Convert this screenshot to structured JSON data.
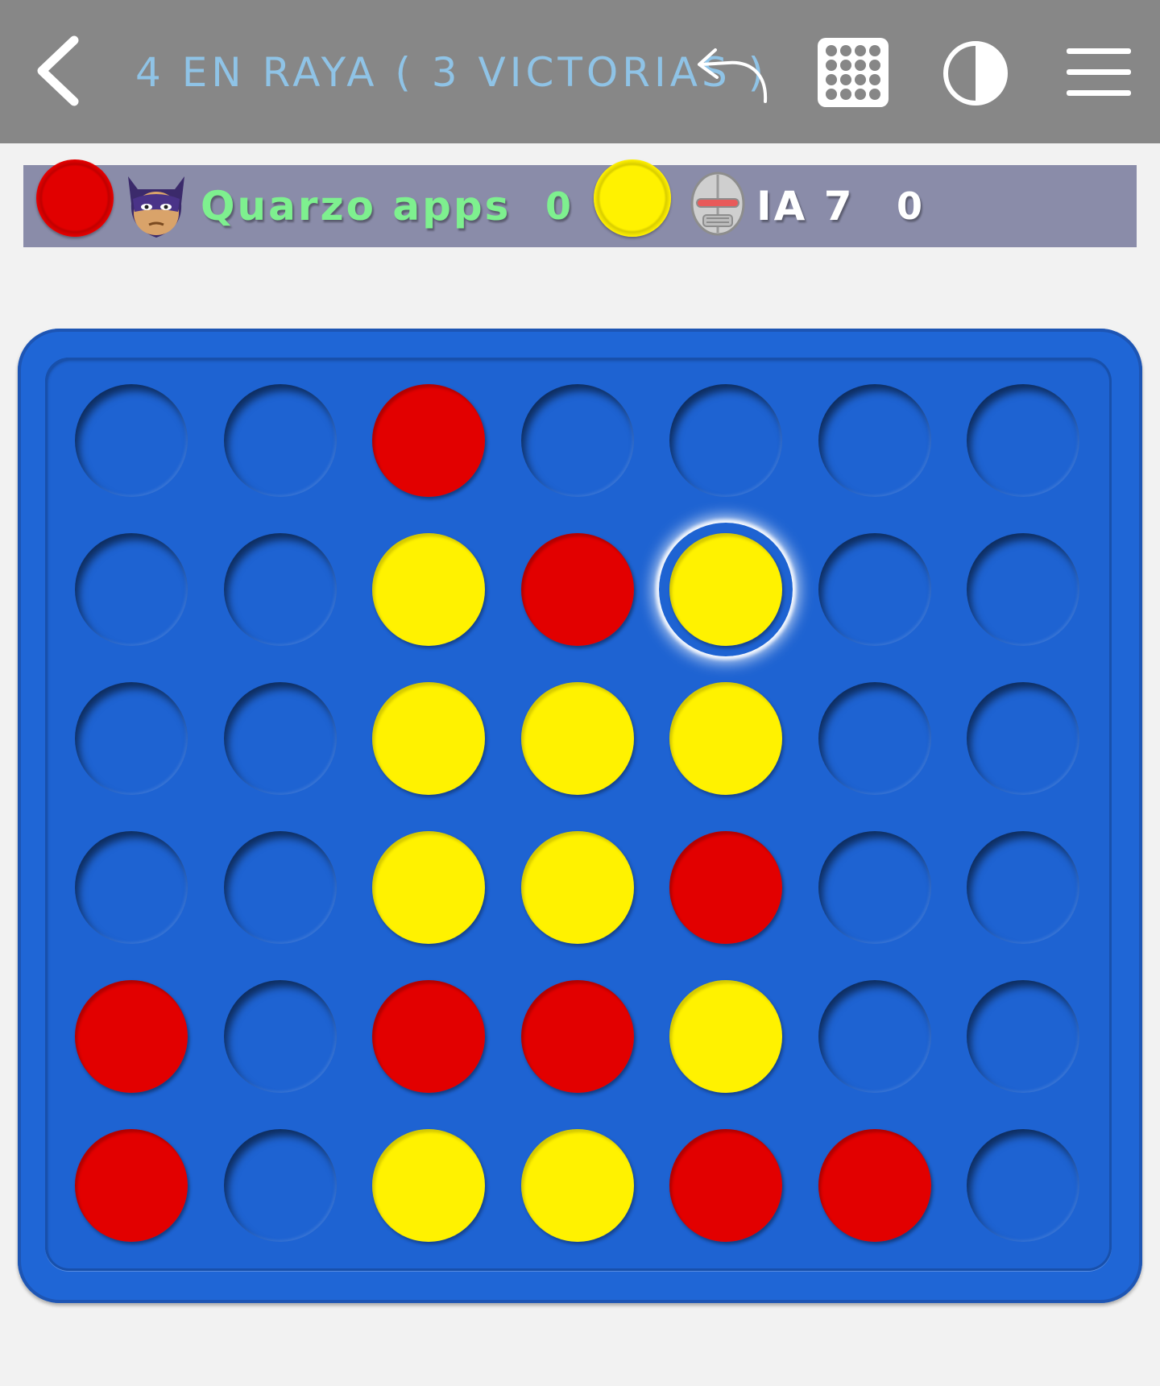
{
  "header": {
    "title": "4 EN RAYA ( 3 VICTORIAS )",
    "back_icon": "chevron-left-icon",
    "undo_icon": "undo-arrow-icon",
    "grid_icon": "dot-grid-icon",
    "contrast_icon": "half-circle-contrast-icon",
    "menu_icon": "hamburger-menu-icon",
    "background_color": "#878787",
    "title_color": "#8fc3e6"
  },
  "players": [
    {
      "name": "Quarzo apps",
      "score": "0",
      "chip_color": "red",
      "avatar": "masked-hero-avatar",
      "name_color": "#7ef08f"
    },
    {
      "name": "IA 7",
      "score": "0",
      "chip_color": "yellow",
      "avatar": "robot-avatar",
      "name_color": "#ffffff"
    }
  ],
  "board": {
    "columns": 7,
    "rows": 6,
    "frame_color": "#1f66d6",
    "red_color": "#e10000",
    "yellow_color": "#fff200",
    "cells": [
      [
        "empty",
        "empty",
        "red",
        "empty",
        "empty",
        "empty",
        "empty"
      ],
      [
        "empty",
        "empty",
        "yellow",
        "red",
        "yellow",
        "empty",
        "empty"
      ],
      [
        "empty",
        "empty",
        "yellow",
        "yellow",
        "yellow",
        "empty",
        "empty"
      ],
      [
        "empty",
        "empty",
        "yellow",
        "yellow",
        "red",
        "empty",
        "empty"
      ],
      [
        "red",
        "empty",
        "red",
        "red",
        "yellow",
        "empty",
        "empty"
      ],
      [
        "red",
        "empty",
        "yellow",
        "yellow",
        "red",
        "red",
        "empty"
      ]
    ],
    "last_move": {
      "row": 2,
      "column": 5
    }
  }
}
